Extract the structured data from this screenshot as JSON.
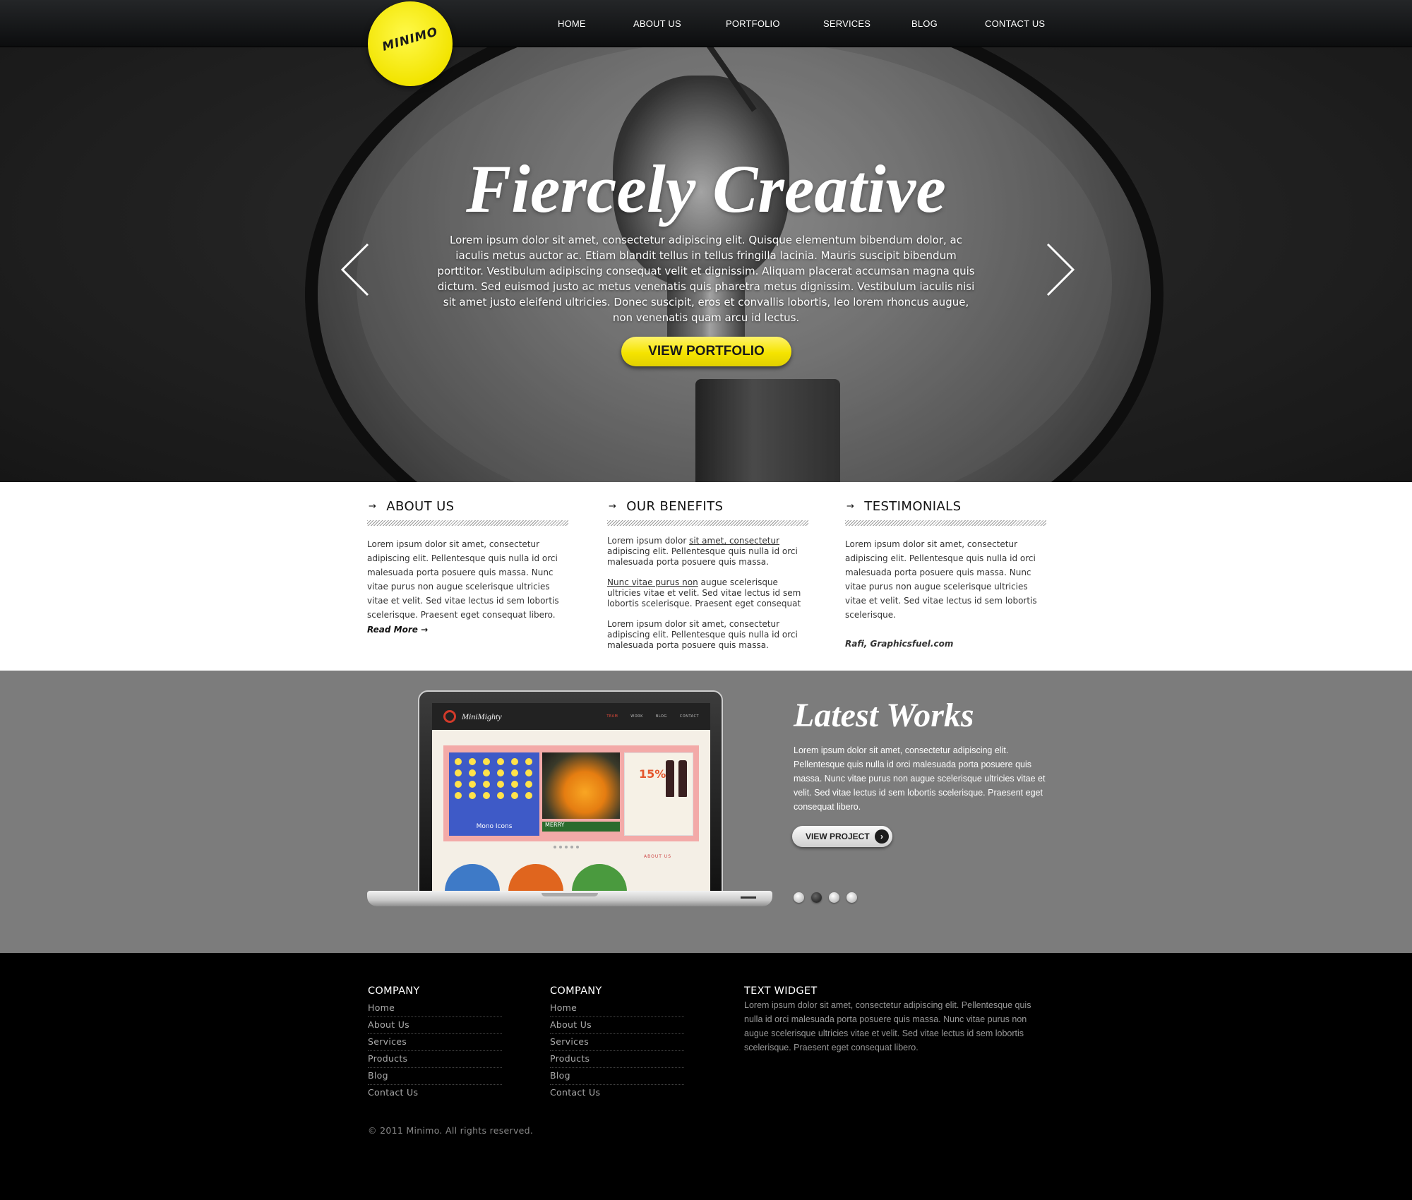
{
  "header": {
    "logo_text": "MINIMO",
    "nav": [
      "HOME",
      "ABOUT US",
      "PORTFOLIO",
      "SERVICES",
      "BLOG",
      "CONTACT US"
    ]
  },
  "hero": {
    "title": "Fiercely Creative",
    "text": "Lorem ipsum dolor sit amet, consectetur adipiscing elit. Quisque elementum bibendum dolor, ac iaculis metus auctor ac. Etiam blandit tellus in tellus fringilla lacinia. Mauris suscipit bibendum porttitor. Vestibulum adipiscing consequat velit et dignissim. Aliquam placerat accumsan magna quis dictum. Sed euismod justo ac metus venenatis quis pharetra metus dignissim. Vestibulum iaculis nisi sit amet justo eleifend ultricies. Donec suscipit, eros et convallis lobortis, leo lorem rhoncus augue, non venenatis quam arcu id lectus.",
    "button": "VIEW PORTFOLIO",
    "arrow_left_icon": "chevron-left-icon",
    "arrow_right_icon": "chevron-right-icon"
  },
  "about": {
    "title": "ABOUT US",
    "text": "Lorem ipsum dolor sit amet, consectetur adipiscing elit. Pellentesque quis nulla id orci malesuada porta posuere quis massa. Nunc vitae purus non augue scelerisque ultricies vitae et velit. Sed vitae lectus id sem lobortis scelerisque. Praesent eget consequat libero.",
    "read_more": "Read More →"
  },
  "benefits": {
    "title": "OUR BENEFITS",
    "p1_before": "Lorem ipsum dolor ",
    "p1_link": "sit amet, consectetur",
    "p1_after": " adipiscing elit. Pellentesque quis nulla id orci malesuada porta posuere quis massa.",
    "p2_link": "Nunc vitae purus non",
    "p2_after": " augue scelerisque ultricies vitae et velit. Sed vitae lectus id sem lobortis scelerisque. Praesent eget consequat",
    "p3": "Lorem ipsum dolor sit amet, consectetur adipiscing elit. Pellentesque quis nulla id orci malesuada porta posuere quis massa."
  },
  "testimonials": {
    "title": "TESTIMONIALS",
    "text": "Lorem ipsum dolor sit amet, consectetur adipiscing elit. Pellentesque quis nulla id orci malesuada porta posuere quis massa. Nunc vitae purus non augue scelerisque ultricies vitae et velit. Sed vitae lectus id sem lobortis scelerisque.",
    "author": "Rafi, Graphicsfuel.com"
  },
  "works": {
    "title": "Latest Works",
    "text": "Lorem ipsum dolor sit amet, consectetur adipiscing elit. Pellentesque quis nulla id orci malesuada porta posuere quis massa. Nunc vitae purus non augue scelerisque ultricies vitae et velit. Sed vitae lectus id sem lobortis scelerisque. Praesent eget consequat libero.",
    "button": "VIEW PROJECT",
    "slider_active_index": 1,
    "laptop": {
      "brand": "MiniMighty",
      "nav": [
        "TEAM",
        "WORK",
        "BLOG",
        "CONTACT"
      ],
      "icons_caption": "Mono Icons",
      "photo_caption": "MERRY",
      "discount": "15%",
      "section_label": "ABOUT US"
    }
  },
  "footer": {
    "col1": {
      "title": "COMPANY",
      "links": [
        "Home",
        "About Us",
        "Services",
        "Products",
        "Blog",
        "Contact Us"
      ]
    },
    "col2": {
      "title": "COMPANY",
      "links": [
        "Home",
        "About Us",
        "Services",
        "Products",
        "Blog",
        "Contact Us"
      ]
    },
    "widget": {
      "title": "TEXT WIDGET",
      "text": "Lorem ipsum dolor sit amet, consectetur adipiscing elit. Pellentesque quis nulla id orci malesuada porta posuere quis massa. Nunc vitae purus non augue scelerisque ultricies vitae et velit. Sed vitae lectus id sem lobortis scelerisque. Praesent eget consequat libero."
    },
    "copyright": "© 2011 Minimo. All rights reserved."
  },
  "colors": {
    "accent": "#f5e400",
    "dark": "#000000",
    "grey": "#7c7c7c"
  }
}
